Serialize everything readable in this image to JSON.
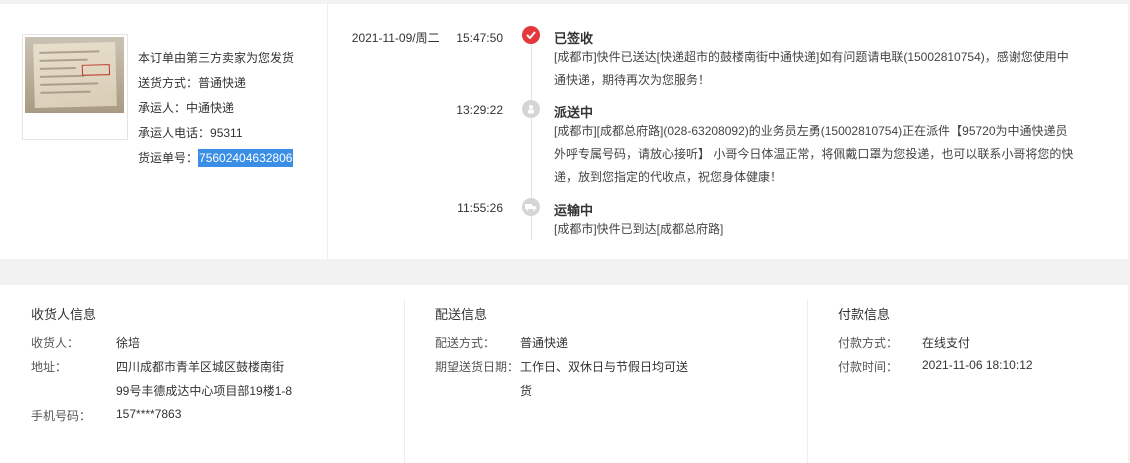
{
  "shipment": {
    "note": "本订单由第三方卖家为您发货",
    "method_label": "送货方式：",
    "method_value": "普通快递",
    "carrier_label": "承运人：",
    "carrier_value": "中通快递",
    "phone_label": "承运人电话：",
    "phone_value": "95311",
    "tracking_label": "货运单号：",
    "tracking_value": "75602404632806"
  },
  "timeline": [
    {
      "date": "2021-11-09/周二",
      "time": "15:47:50",
      "status": "已签收",
      "icon": "check-icon",
      "lines": [
        "[成都市]快件已送达[快递超市的鼓楼南街中通快递]如有问题请电联(15002810754)，感谢您使用中",
        "通快递，期待再次为您服务！"
      ]
    },
    {
      "date": "",
      "time": "13:29:22",
      "status": "派送中",
      "icon": "courier-icon",
      "lines": [
        "[成都市][成都总府路](028-63208092)的业务员左勇(15002810754)正在派件【95720为中通快递员",
        "外呼专属号码，请放心接听】 小哥今日体温正常，将佩戴口罩为您投递，也可以联系小哥将您的快",
        "递，放到您指定的代收点，祝您身体健康！"
      ]
    },
    {
      "date": "",
      "time": "11:55:26",
      "status": "运输中",
      "icon": "truck-icon",
      "lines": [
        "[成都市]快件已到达[成都总府路]"
      ]
    }
  ],
  "receiver": {
    "title": "收货人信息",
    "name_label": "收货人：",
    "name_value": "徐培",
    "address_label": "地址：",
    "address_line1": "四川成都市青羊区城区鼓楼南街",
    "address_line2": "99号丰德成达中心项目部19楼1-8",
    "phone_label": "手机号码：",
    "phone_value": "157****7863"
  },
  "delivery": {
    "title": "配送信息",
    "method_label": "配送方式：",
    "method_value": "普通快递",
    "date_label": "期望送货日期：",
    "date_line1": "工作日、双休日与节假日均可送",
    "date_line2": "货"
  },
  "payment": {
    "title": "付款信息",
    "method_label": "付款方式：",
    "method_value": "在线支付",
    "time_label": "付款时间：",
    "time_value": "2021-11-06 18:10:12"
  },
  "colors": {
    "accent": "#e4393c",
    "highlight": "#3a8ee6",
    "inactive_dot": "#d5d5d5"
  }
}
